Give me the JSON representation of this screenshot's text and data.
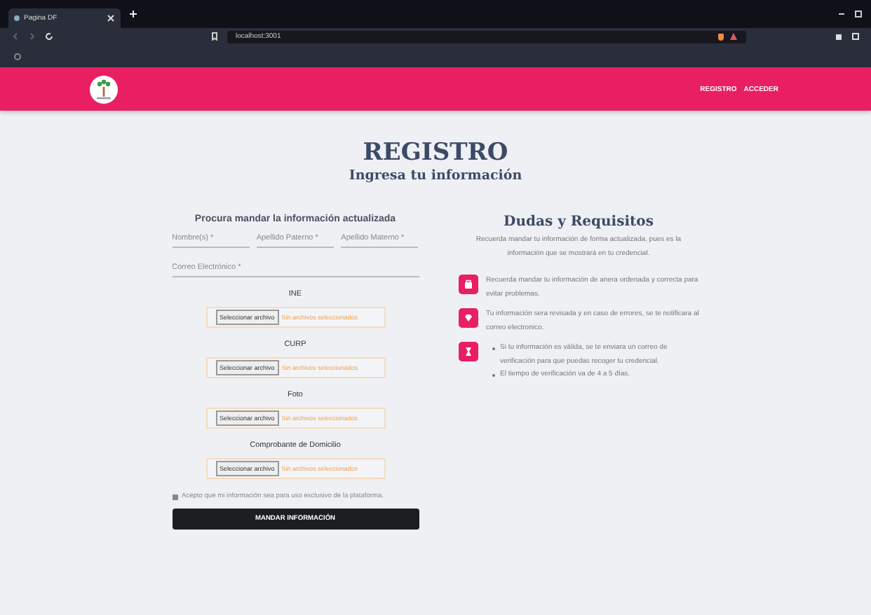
{
  "browser": {
    "tab_title": "Pagina DF",
    "address": "localhost:3001"
  },
  "header": {
    "nav": [
      "REGISTRO",
      "ACCEDER"
    ]
  },
  "page": {
    "title": "REGISTRO",
    "subtitle": "Ingresa tu información"
  },
  "form": {
    "heading": "Procura mandar la información actualizada",
    "name_fields": [
      {
        "placeholder": "Nombre(s) *"
      },
      {
        "placeholder": "Apellido Paterno *"
      },
      {
        "placeholder": "Apellido Materno *"
      }
    ],
    "email_field": {
      "placeholder": "Correo Electrónico *"
    },
    "uploads": [
      {
        "label": "INE",
        "button": "Seleccionar archivo",
        "status": "Sin archivos seleccionados"
      },
      {
        "label": "CURP",
        "button": "Seleccionar archivo",
        "status": "Sin archivos seleccionados"
      },
      {
        "label": "Foto",
        "button": "Seleccionar archivo",
        "status": "Sin archivos seleccionados"
      },
      {
        "label": "Comprobante de Domicilio",
        "button": "Seleccionar archivo",
        "status": "Sin archivos seleccionados"
      }
    ],
    "consent": {
      "label": "Acepto que mi información sea para uso exclusivo de la plataforma.",
      "checked": false
    },
    "submit": "MANDAR INFORMACIÓN"
  },
  "info": {
    "heading": "Dudas y Requisitos",
    "intro": "Recuerda mandar tu información de forma actualizada, pues es la información que se mostrará en tu credencial.",
    "items": [
      {
        "kind": "text",
        "text": "Recuerda mandar tu información de anera ordenada y correcta para evitar problemas."
      },
      {
        "kind": "text",
        "text": "Tu información sera revisada y en caso de errores, se te notificara al correo electronico."
      },
      {
        "kind": "list",
        "bullets": [
          "Si tu información es válida, se te enviara un correo de verificación para que puedas recoger tu credencial.",
          "El tiempo de verificación va de 4 a 5 días."
        ]
      }
    ]
  }
}
